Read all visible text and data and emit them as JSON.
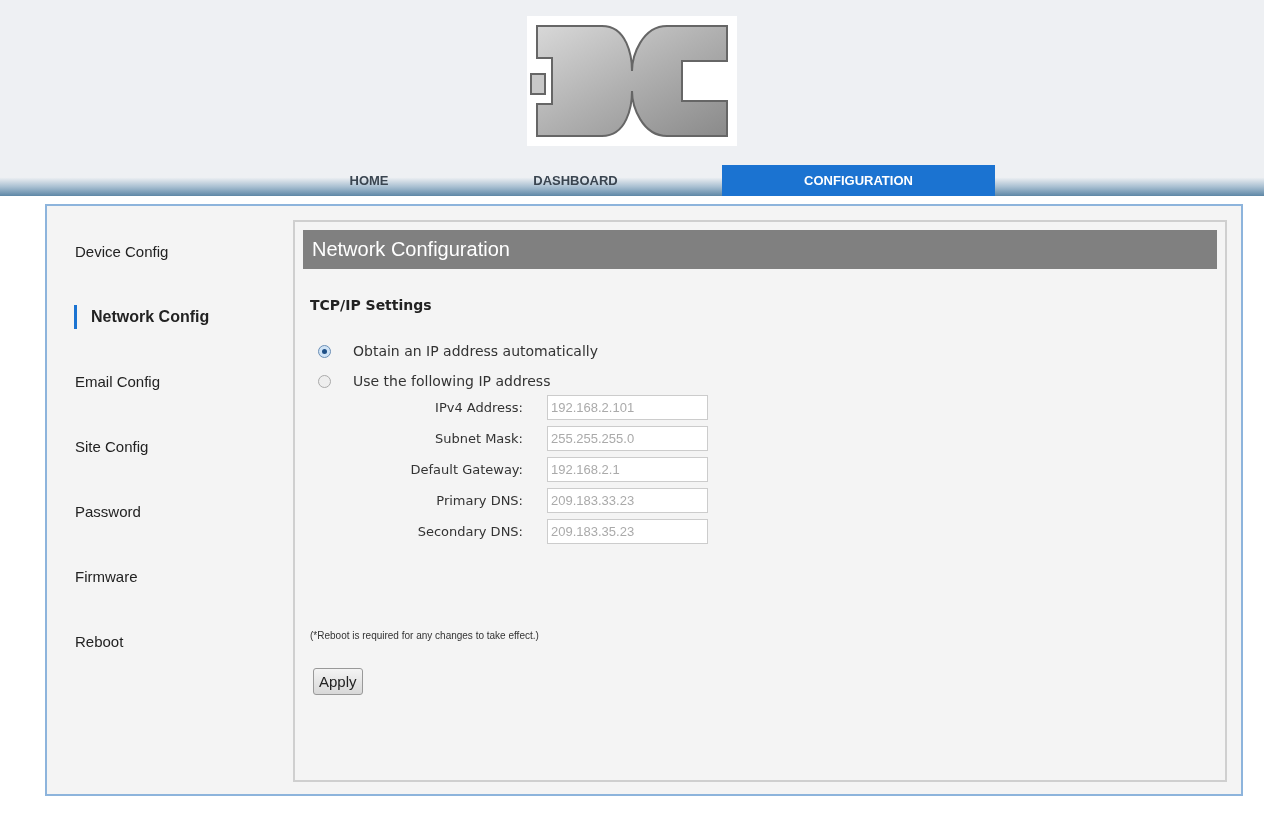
{
  "nav": {
    "tabs": [
      {
        "label": "HOME",
        "selected": false
      },
      {
        "label": "DASHBOARD",
        "selected": false
      },
      {
        "label": "CONFIGURATION",
        "selected": true
      }
    ]
  },
  "sidebar": {
    "items": [
      {
        "label": "Device Config",
        "selected": false
      },
      {
        "label": "Network Config",
        "selected": true
      },
      {
        "label": "Email Config",
        "selected": false
      },
      {
        "label": "Site Config",
        "selected": false
      },
      {
        "label": "Password",
        "selected": false
      },
      {
        "label": "Firmware",
        "selected": false
      },
      {
        "label": "Reboot",
        "selected": false
      }
    ]
  },
  "panel": {
    "title": "Network Configuration",
    "section": "TCP/IP Settings",
    "options": [
      {
        "label": "Obtain an IP address automatically",
        "selected": true
      },
      {
        "label": "Use the following IP address",
        "selected": false
      }
    ],
    "fields": [
      {
        "label": "IPv4 Address:",
        "value": "192.168.2.101",
        "disabled": true
      },
      {
        "label": "Subnet Mask:",
        "value": "255.255.255.0",
        "disabled": true
      },
      {
        "label": "Default Gateway:",
        "value": "192.168.2.1",
        "disabled": true
      },
      {
        "label": "Primary DNS:",
        "value": "209.183.33.23",
        "disabled": true
      },
      {
        "label": "Secondary DNS:",
        "value": "209.183.35.23",
        "disabled": true
      }
    ],
    "note": "(*Reboot is required for any changes to take effect.)",
    "button": "Apply"
  }
}
